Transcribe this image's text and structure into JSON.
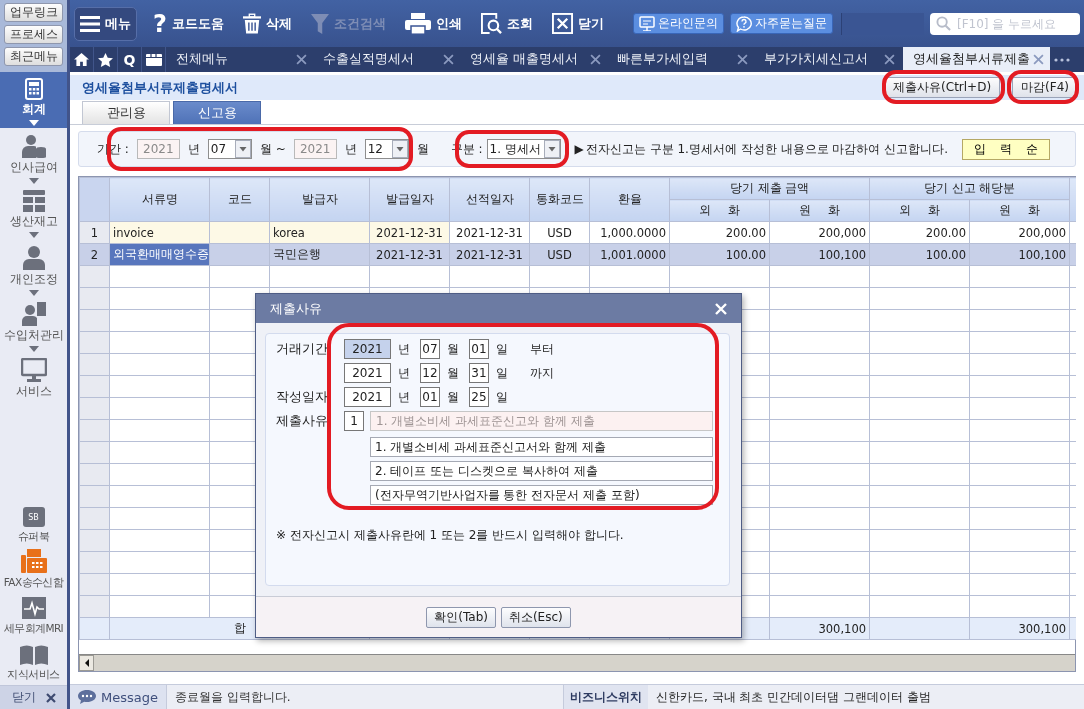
{
  "side_buttons": [
    "업무링크",
    "프로세스",
    "최근메뉴"
  ],
  "toolbar": {
    "items": [
      {
        "kind": "menu",
        "label": "메뉴",
        "disabled": false
      },
      {
        "kind": "tool",
        "label": "코드도움",
        "glyph": "?",
        "disabled": false
      },
      {
        "kind": "tool",
        "label": "삭제",
        "disabled": false
      },
      {
        "kind": "tool",
        "label": "조건검색",
        "disabled": true
      },
      {
        "kind": "tool",
        "label": "인쇄",
        "disabled": false
      },
      {
        "kind": "tool",
        "label": "조회",
        "disabled": false
      },
      {
        "kind": "tool",
        "label": "닫기",
        "disabled": false
      }
    ],
    "help_buttons": [
      "온라인문의",
      "자주묻는질문"
    ],
    "search": {
      "placeholder": "[F10] 을 누르세요"
    }
  },
  "tab_bar": {
    "quick_key": "Q",
    "tabs": [
      {
        "label": "전체메뉴",
        "selected": false
      },
      {
        "label": "수출실적명세서",
        "selected": false
      },
      {
        "label": "영세율 매출명세서",
        "selected": false
      },
      {
        "label": "빠른부가세입력",
        "selected": false
      },
      {
        "label": "부가가치세신고서",
        "selected": false
      },
      {
        "label": "영세율첨부서류제출",
        "selected": true
      }
    ]
  },
  "sidebar": {
    "items": [
      {
        "label": "회계",
        "selected": true,
        "expandable": true
      },
      {
        "label": "인사급여",
        "selected": false,
        "expandable": true
      },
      {
        "label": "생산재고",
        "selected": false,
        "expandable": true
      },
      {
        "label": "개인조정",
        "selected": false,
        "expandable": true
      },
      {
        "label": "수입처관리",
        "selected": false,
        "expandable": true
      },
      {
        "label": "서비스",
        "selected": false,
        "expandable": false
      }
    ],
    "services": [
      {
        "label": "슈퍼북",
        "badge": "SB"
      },
      {
        "label": "FAX송수신함"
      },
      {
        "label": "세무회계MRI"
      },
      {
        "label": "지식서비스"
      }
    ],
    "close_label": "닫기"
  },
  "page": {
    "title": "영세율첨부서류제출명세서",
    "buttons": [
      "제출사유(Ctrl+D)",
      "마감(F4)"
    ],
    "view_tabs": [
      {
        "label": "관리용",
        "selected": false
      },
      {
        "label": "신고용",
        "selected": true
      }
    ]
  },
  "filter": {
    "period_label": "기간 :",
    "start": {
      "year": "2021",
      "year_disabled": true,
      "year_unit": "년",
      "month": "07",
      "month_unit": "월 ~"
    },
    "end": {
      "year": "2021",
      "year_disabled": true,
      "year_unit": "년",
      "month": "12",
      "month_unit": "월"
    },
    "type_label": "구분 :",
    "type_value": "1. 명세서",
    "notice_marker": "▶",
    "notice": "전자신고는 구분 1.명세서에 작성한 내용으로 마감하여 신고합니다.",
    "order_button": "입 력 순"
  },
  "table": {
    "columns": [
      "서류명",
      "코드",
      "발급자",
      "발급일자",
      "선적일자",
      "통화코드",
      "환율"
    ],
    "groups": [
      {
        "label": "당기 제출 금액",
        "columns": [
          "외 화",
          "원 화"
        ]
      },
      {
        "label": "당기 신고 해당분",
        "columns": [
          "외 화",
          "원 화"
        ]
      }
    ],
    "rows": [
      {
        "number": "1",
        "selected": false,
        "doc_name": "invoice",
        "issuer": "korea",
        "issue_date": "2021-12-31",
        "shipping_date": "2021-12-31",
        "currency": "USD",
        "rate": "1,000.0000",
        "submit_foreign": "200.00",
        "submit_won": "200,000",
        "report_foreign": "200.00",
        "report_won": "200,000"
      },
      {
        "number": "2",
        "selected": true,
        "doc_name": "외국환매매영수증",
        "issuer": "국민은행",
        "issue_date": "2021-12-31",
        "shipping_date": "2021-12-31",
        "currency": "USD",
        "rate": "1,001.0000",
        "submit_foreign": "100.00",
        "submit_won": "100,100",
        "report_foreign": "100.00",
        "report_won": "100,100"
      }
    ],
    "total": {
      "label": "합",
      "submit_won": "300,100",
      "report_won": "300,100"
    }
  },
  "dialog": {
    "title": "제출사유",
    "dates": [
      {
        "label": "거래기간",
        "year": "2021",
        "year_selected": true,
        "year_unit": "년",
        "month": "07",
        "month_unit": "월",
        "day": "01",
        "day_unit": "일",
        "suffix": "부터"
      },
      {
        "year": "2021",
        "year_selected": false,
        "year_unit": "년",
        "month": "12",
        "month_unit": "월",
        "day": "31",
        "day_unit": "일",
        "suffix": "까지"
      },
      {
        "label": "작성일자",
        "year": "2021",
        "year_selected": false,
        "year_unit": "년",
        "month": "01",
        "month_unit": "월",
        "day": "25",
        "day_unit": "일"
      }
    ],
    "reason": {
      "label": "제출사유",
      "code": "1",
      "text": "1. 개별소비세 과세표준신고와 함께 제출",
      "disabled": true,
      "options": [
        "1. 개별소비세 과세표준신고서와 함께 제출",
        "2. 테이프 또는 디스켓으로 복사하여 제출",
        "(전자무역기반사업자를 통한 전자문서 제출 포함)"
      ]
    },
    "note": "※ 전자신고시 제출사유란에 1 또는 2를 반드시 입력해야 합니다.",
    "buttons": [
      "확인(Tab)",
      "취소(Esc)"
    ]
  },
  "status_bar": {
    "message_label": "Message",
    "message": "종료월을 입력합니다.",
    "news_label": "비즈니스위치",
    "news": "신한카드, 국내 최초 민간데이터댐 그랜데이터 출범"
  }
}
